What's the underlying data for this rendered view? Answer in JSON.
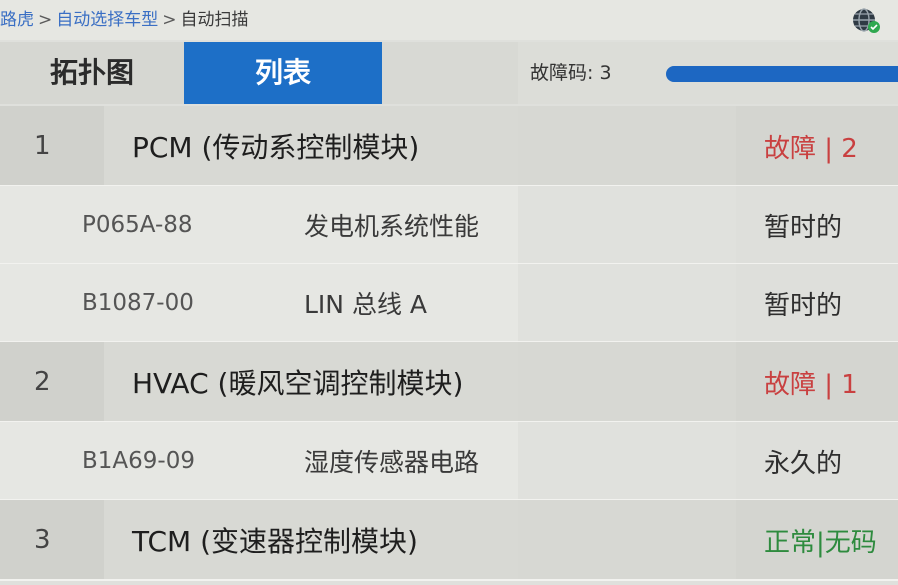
{
  "breadcrumb": {
    "items": [
      "路虎",
      "自动选择车型",
      "自动扫描"
    ],
    "separator": ">"
  },
  "tabs": [
    {
      "label": "拓扑图",
      "active": false
    },
    {
      "label": "列表",
      "active": true
    }
  ],
  "status": {
    "fault_count_label": "故障码: 3",
    "progress_fraction": 1.0
  },
  "modules": [
    {
      "index": "1",
      "name": "PCM (传动系控制模块)",
      "status": "故障 | 2",
      "status_color": "#c94040",
      "codes": [
        {
          "code": "P065A-88",
          "description": "发电机系统性能",
          "type": "暂时的"
        },
        {
          "code": "B1087-00",
          "description": "LIN 总线 A",
          "type": "暂时的"
        }
      ]
    },
    {
      "index": "2",
      "name": "HVAC (暖风空调控制模块)",
      "status": "故障 | 1",
      "status_color": "#c94040",
      "codes": [
        {
          "code": "B1A69-09",
          "description": "湿度传感器电路",
          "type": "永久的"
        }
      ]
    },
    {
      "index": "3",
      "name": "TCM (变速器控制模块)",
      "status": "正常|无码",
      "status_color": "#2e8b3e",
      "codes": []
    }
  ],
  "colors": {
    "accent": "#1d6fc7",
    "fault": "#c94040",
    "ok": "#2e8b3e",
    "link": "#3a6fc4"
  },
  "icons": {
    "globe": "globe-icon"
  }
}
